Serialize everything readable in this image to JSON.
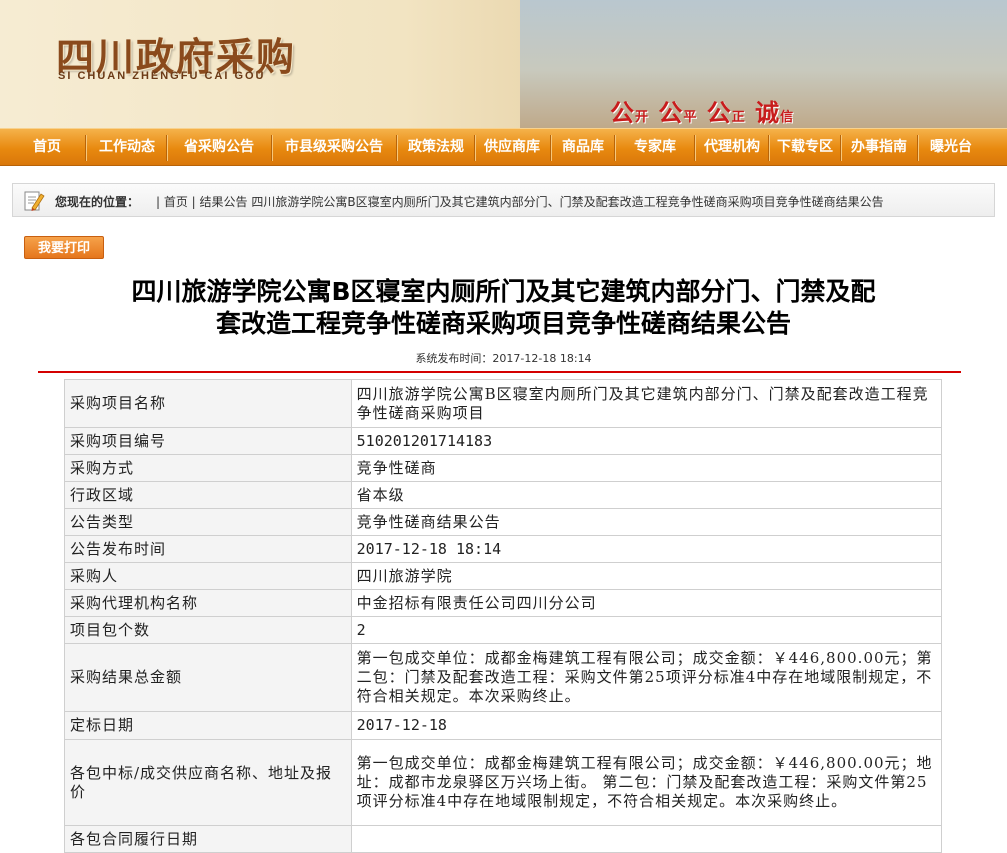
{
  "header": {
    "logo_cn": "四川政府采购",
    "logo_en": "SI CHUAN ZHENGFU CAI GOU",
    "slogan": [
      {
        "big": "公",
        "small": "开"
      },
      {
        "big": "公",
        "small": "平"
      },
      {
        "big": "公",
        "small": "正"
      },
      {
        "big": "诚",
        "small": "信"
      }
    ]
  },
  "nav": {
    "items": [
      "首页",
      "工作动态",
      "省采购公告",
      "市县级采购公告",
      "政策法规",
      "供应商库",
      "商品库",
      "专家库",
      "代理机构",
      "下载专区",
      "办事指南",
      "曝光台"
    ]
  },
  "breadcrumb": {
    "label": "您现在的位置：",
    "path": "| 首页 | 结果公告 四川旅游学院公寓B区寝室内厕所门及其它建筑内部分门、门禁及配套改造工程竞争性磋商采购项目竞争性磋商结果公告"
  },
  "print_button": "我要打印",
  "article": {
    "title_line1": "四川旅游学院公寓B区寝室内厕所门及其它建筑内部分门、门禁及配",
    "title_line2": "套改造工程竞争性磋商采购项目竞争性磋商结果公告",
    "pub_time": "系统发布时间：2017-12-18  18:14"
  },
  "table": {
    "rows": [
      {
        "k": "采购项目名称",
        "v": "四川旅游学院公寓B区寝室内厕所门及其它建筑内部分门、门禁及配套改造工程竞争性磋商采购项目"
      },
      {
        "k": "采购项目编号",
        "v": "510201201714183"
      },
      {
        "k": "采购方式",
        "v": "竞争性磋商"
      },
      {
        "k": "行政区域",
        "v": "省本级"
      },
      {
        "k": "公告类型",
        "v": "竞争性磋商结果公告"
      },
      {
        "k": "公告发布时间",
        "v": "2017-12-18  18:14"
      },
      {
        "k": "采购人",
        "v": "四川旅游学院"
      },
      {
        "k": "采购代理机构名称",
        "v": "中金招标有限责任公司四川分公司"
      },
      {
        "k": "项目包个数",
        "v": "2"
      },
      {
        "k": "采购结果总金额",
        "v": "第一包成交单位：成都金梅建筑工程有限公司；成交金额：￥446,800.00元；第二包：门禁及配套改造工程：采购文件第25项评分标准4中存在地域限制规定，不符合相关规定。本次采购终止。"
      },
      {
        "k": "定标日期",
        "v": "2017-12-18"
      },
      {
        "k": "各包中标/成交供应商名称、地址及报价",
        "v": "第一包成交单位：成都金梅建筑工程有限公司；成交金额：￥446,800.00元；地址：成都市龙泉驿区万兴场上街。 第二包：门禁及配套改造工程：采购文件第25项评分标准4中存在地域限制规定，不符合相关规定。本次采购终止。"
      },
      {
        "k": "各包合同履行日期",
        "v": ""
      }
    ]
  }
}
